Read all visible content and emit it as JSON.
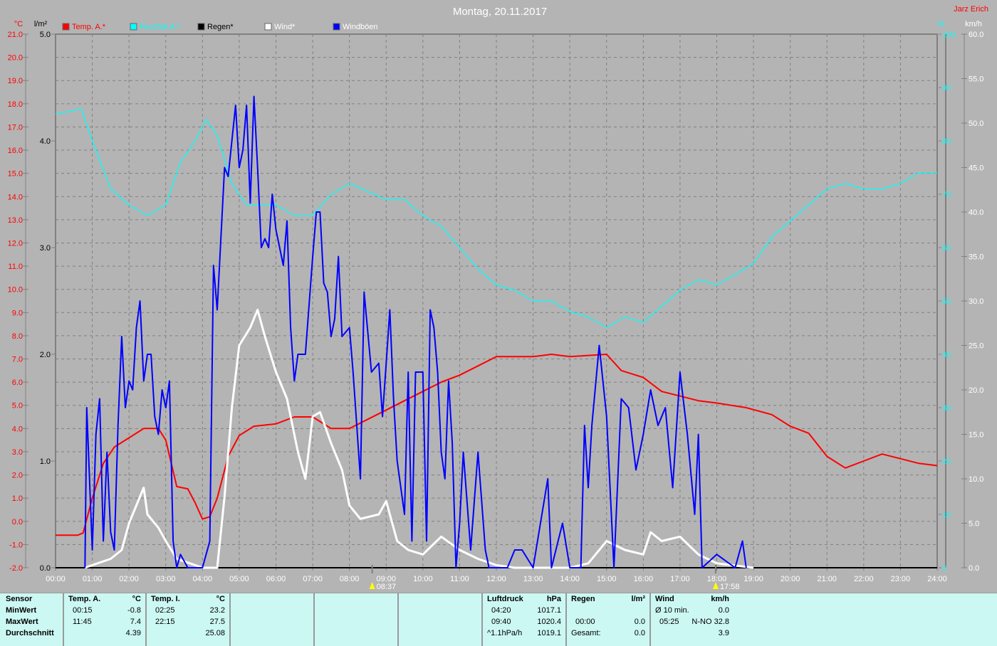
{
  "chart_data": {
    "type": "line",
    "title": "Montag, 20.11.2017",
    "author": "Jarz Erich",
    "legend": [
      {
        "name": "Temp. A.*",
        "color": "#ff0000"
      },
      {
        "name": "Feuchte A.*",
        "color": "#00ffff"
      },
      {
        "name": "Regen*",
        "color": "#000000"
      },
      {
        "name": "Wind*",
        "color": "#ffffff"
      },
      {
        "name": "Windböen",
        "color": "#0000ff"
      }
    ],
    "axes": {
      "temp": {
        "label": "°C",
        "range": [
          -2,
          21
        ],
        "step": 1
      },
      "rain": {
        "label": "l/m²",
        "range": [
          0,
          5
        ],
        "step": 1
      },
      "hum": {
        "label": "%",
        "range": [
          0,
          100
        ],
        "step": 10
      },
      "wind": {
        "label": "km/h",
        "range": [
          0,
          60
        ],
        "step": 5
      },
      "x": {
        "range": [
          0,
          24
        ],
        "ticks": [
          "00:00",
          "01:00",
          "02:00",
          "03:00",
          "04:00",
          "05:00",
          "06:00",
          "07:00",
          "08:00",
          "09:00",
          "10:00",
          "11:00",
          "12:00",
          "13:00",
          "14:00",
          "15:00",
          "16:00",
          "17:00",
          "18:00",
          "19:00",
          "20:00",
          "21:00",
          "22:00",
          "23:00",
          "24:00"
        ]
      }
    },
    "sunrise": {
      "time": "08:37",
      "hour": 8.62
    },
    "sunset": {
      "time": "17:58",
      "hour": 17.97
    },
    "series": [
      {
        "name": "Temp. A.*",
        "axis": "temp",
        "color": "#ff0000",
        "points": [
          [
            0,
            -0.6
          ],
          [
            0.6,
            -0.6
          ],
          [
            0.75,
            -0.5
          ],
          [
            1,
            1
          ],
          [
            1.3,
            2.5
          ],
          [
            1.6,
            3.2
          ],
          [
            2,
            3.6
          ],
          [
            2.4,
            4
          ],
          [
            2.8,
            4
          ],
          [
            3,
            3.5
          ],
          [
            3.3,
            1.5
          ],
          [
            3.6,
            1.4
          ],
          [
            3.8,
            0.8
          ],
          [
            4,
            0.1
          ],
          [
            4.2,
            0.2
          ],
          [
            4.4,
            1
          ],
          [
            4.7,
            2.8
          ],
          [
            5,
            3.7
          ],
          [
            5.4,
            4.1
          ],
          [
            6,
            4.2
          ],
          [
            6.5,
            4.5
          ],
          [
            7,
            4.5
          ],
          [
            7.5,
            4
          ],
          [
            8,
            4
          ],
          [
            8.5,
            4.4
          ],
          [
            9,
            4.8
          ],
          [
            9.5,
            5.2
          ],
          [
            10,
            5.6
          ],
          [
            10.5,
            6
          ],
          [
            11,
            6.3
          ],
          [
            11.5,
            6.7
          ],
          [
            12,
            7.1
          ],
          [
            13,
            7.1
          ],
          [
            13.5,
            7.2
          ],
          [
            14,
            7.1
          ],
          [
            15,
            7.2
          ],
          [
            15.4,
            6.5
          ],
          [
            16,
            6.2
          ],
          [
            16.5,
            5.6
          ],
          [
            17,
            5.4
          ],
          [
            17.5,
            5.2
          ],
          [
            18,
            5.1
          ],
          [
            18.8,
            4.9
          ],
          [
            19.5,
            4.6
          ],
          [
            20,
            4.1
          ],
          [
            20.5,
            3.8
          ],
          [
            21,
            2.8
          ],
          [
            21.5,
            2.3
          ],
          [
            22,
            2.6
          ],
          [
            22.5,
            2.9
          ],
          [
            23,
            2.7
          ],
          [
            23.5,
            2.5
          ],
          [
            24,
            2.4
          ]
        ]
      },
      {
        "name": "Feuchte A.*",
        "axis": "hum",
        "color": "#00ffff",
        "points": [
          [
            0,
            85
          ],
          [
            0.7,
            86
          ],
          [
            1,
            80
          ],
          [
            1.5,
            71
          ],
          [
            2,
            68
          ],
          [
            2.5,
            66
          ],
          [
            3,
            68
          ],
          [
            3.4,
            76
          ],
          [
            3.8,
            80
          ],
          [
            4.1,
            84
          ],
          [
            4.4,
            81
          ],
          [
            4.8,
            72
          ],
          [
            5.2,
            68
          ],
          [
            6,
            68
          ],
          [
            6.5,
            66
          ],
          [
            7,
            66
          ],
          [
            7.5,
            70
          ],
          [
            8,
            72
          ],
          [
            9,
            69
          ],
          [
            9.5,
            69
          ],
          [
            10,
            66
          ],
          [
            10.5,
            64
          ],
          [
            11,
            60
          ],
          [
            11.5,
            56
          ],
          [
            12,
            53
          ],
          [
            12.5,
            52
          ],
          [
            13,
            50
          ],
          [
            13.5,
            50
          ],
          [
            14,
            48
          ],
          [
            14.5,
            47
          ],
          [
            15,
            45
          ],
          [
            15.5,
            47
          ],
          [
            16,
            46
          ],
          [
            16.5,
            49
          ],
          [
            17,
            52
          ],
          [
            17.5,
            54
          ],
          [
            18,
            53
          ],
          [
            18.5,
            55
          ],
          [
            19,
            57
          ],
          [
            19.5,
            62
          ],
          [
            20,
            65
          ],
          [
            20.5,
            68
          ],
          [
            21,
            71
          ],
          [
            21.5,
            72
          ],
          [
            22,
            71
          ],
          [
            22.5,
            71
          ],
          [
            23,
            72
          ],
          [
            23.5,
            74
          ],
          [
            24,
            74
          ]
        ]
      },
      {
        "name": "Wind*",
        "axis": "wind",
        "color": "#ffffff",
        "points": [
          [
            0.8,
            0
          ],
          [
            1,
            0.3
          ],
          [
            1.5,
            1
          ],
          [
            1.8,
            2
          ],
          [
            2,
            5
          ],
          [
            2.3,
            8
          ],
          [
            2.4,
            9
          ],
          [
            2.5,
            6
          ],
          [
            2.8,
            4.5
          ],
          [
            3,
            3
          ],
          [
            3.3,
            1
          ],
          [
            3.8,
            0.3
          ],
          [
            4,
            0
          ],
          [
            4.4,
            0
          ],
          [
            4.6,
            8
          ],
          [
            4.8,
            18
          ],
          [
            5,
            25
          ],
          [
            5.3,
            27
          ],
          [
            5.5,
            29
          ],
          [
            5.7,
            26
          ],
          [
            6,
            22
          ],
          [
            6.3,
            19
          ],
          [
            6.6,
            13
          ],
          [
            6.8,
            10
          ],
          [
            7,
            17
          ],
          [
            7.2,
            17.5
          ],
          [
            7.5,
            14
          ],
          [
            7.8,
            11
          ],
          [
            8,
            7
          ],
          [
            8.3,
            5.5
          ],
          [
            8.8,
            6
          ],
          [
            9,
            7.5
          ],
          [
            9.3,
            3
          ],
          [
            9.6,
            2
          ],
          [
            10,
            1.5
          ],
          [
            10.5,
            3.5
          ],
          [
            11,
            2
          ],
          [
            11.5,
            1
          ],
          [
            12,
            0.3
          ],
          [
            12.5,
            0
          ],
          [
            14,
            0
          ],
          [
            14.5,
            0.5
          ],
          [
            15,
            3
          ],
          [
            15.5,
            2
          ],
          [
            16,
            1.5
          ],
          [
            16.2,
            4
          ],
          [
            16.5,
            3
          ],
          [
            17,
            3.5
          ],
          [
            17.5,
            1.5
          ],
          [
            18,
            0.5
          ],
          [
            19,
            0
          ]
        ]
      },
      {
        "name": "Windböen",
        "axis": "wind",
        "color": "#0000ff",
        "points": [
          [
            0.8,
            0
          ],
          [
            0.85,
            18
          ],
          [
            1,
            2
          ],
          [
            1.1,
            15
          ],
          [
            1.2,
            19
          ],
          [
            1.3,
            3
          ],
          [
            1.4,
            13
          ],
          [
            1.5,
            4
          ],
          [
            1.6,
            2
          ],
          [
            1.7,
            16
          ],
          [
            1.8,
            26
          ],
          [
            1.9,
            18
          ],
          [
            2,
            21
          ],
          [
            2.1,
            20
          ],
          [
            2.2,
            27
          ],
          [
            2.3,
            30
          ],
          [
            2.4,
            21
          ],
          [
            2.5,
            24
          ],
          [
            2.6,
            24
          ],
          [
            2.7,
            17
          ],
          [
            2.8,
            15
          ],
          [
            2.9,
            20
          ],
          [
            3,
            18
          ],
          [
            3.1,
            21
          ],
          [
            3.2,
            3
          ],
          [
            3.3,
            0
          ],
          [
            3.4,
            1.5
          ],
          [
            3.6,
            0
          ],
          [
            4,
            0
          ],
          [
            4.2,
            3
          ],
          [
            4.3,
            34
          ],
          [
            4.4,
            29
          ],
          [
            4.6,
            45
          ],
          [
            4.7,
            44
          ],
          [
            4.9,
            52
          ],
          [
            5,
            45
          ],
          [
            5.1,
            47
          ],
          [
            5.2,
            52
          ],
          [
            5.3,
            41
          ],
          [
            5.4,
            53
          ],
          [
            5.5,
            45
          ],
          [
            5.6,
            36
          ],
          [
            5.7,
            37
          ],
          [
            5.8,
            36
          ],
          [
            5.9,
            42
          ],
          [
            6,
            38
          ],
          [
            6.2,
            34
          ],
          [
            6.3,
            39
          ],
          [
            6.4,
            27
          ],
          [
            6.5,
            21
          ],
          [
            6.6,
            24
          ],
          [
            6.8,
            24
          ],
          [
            7,
            35
          ],
          [
            7.1,
            40
          ],
          [
            7.2,
            40
          ],
          [
            7.3,
            32
          ],
          [
            7.4,
            31
          ],
          [
            7.5,
            26
          ],
          [
            7.6,
            28
          ],
          [
            7.7,
            35
          ],
          [
            7.8,
            26
          ],
          [
            8,
            27
          ],
          [
            8.1,
            22
          ],
          [
            8.3,
            10
          ],
          [
            8.4,
            31
          ],
          [
            8.6,
            22
          ],
          [
            8.8,
            23
          ],
          [
            8.9,
            17
          ],
          [
            9,
            23
          ],
          [
            9.1,
            29
          ],
          [
            9.2,
            19
          ],
          [
            9.3,
            12
          ],
          [
            9.5,
            6
          ],
          [
            9.6,
            22
          ],
          [
            9.7,
            3
          ],
          [
            9.8,
            22
          ],
          [
            10,
            22
          ],
          [
            10.1,
            3
          ],
          [
            10.2,
            29
          ],
          [
            10.3,
            27
          ],
          [
            10.4,
            22
          ],
          [
            10.5,
            13
          ],
          [
            10.6,
            10
          ],
          [
            10.7,
            21
          ],
          [
            10.8,
            14
          ],
          [
            10.9,
            0
          ],
          [
            11,
            5
          ],
          [
            11.1,
            13
          ],
          [
            11.3,
            2
          ],
          [
            11.5,
            13
          ],
          [
            11.7,
            2
          ],
          [
            11.8,
            0
          ],
          [
            12.3,
            0
          ],
          [
            12.5,
            2
          ],
          [
            12.7,
            2
          ],
          [
            13,
            0
          ],
          [
            13.4,
            10
          ],
          [
            13.5,
            0
          ],
          [
            13.8,
            5
          ],
          [
            14,
            0
          ],
          [
            14.3,
            0
          ],
          [
            14.4,
            16
          ],
          [
            14.5,
            9
          ],
          [
            14.6,
            16
          ],
          [
            14.8,
            25
          ],
          [
            15,
            17
          ],
          [
            15.2,
            0
          ],
          [
            15.4,
            19
          ],
          [
            15.6,
            18
          ],
          [
            15.8,
            11
          ],
          [
            16,
            15
          ],
          [
            16.2,
            20
          ],
          [
            16.4,
            16
          ],
          [
            16.6,
            18
          ],
          [
            16.8,
            9
          ],
          [
            17,
            22
          ],
          [
            17.2,
            15
          ],
          [
            17.4,
            6
          ],
          [
            17.5,
            15
          ],
          [
            17.6,
            0
          ],
          [
            18,
            1.5
          ],
          [
            18.5,
            0
          ],
          [
            18.7,
            3
          ],
          [
            18.8,
            0
          ]
        ]
      }
    ]
  },
  "table": {
    "sensor": {
      "header": "Sensor",
      "rows": [
        "MinWert",
        "MaxWert",
        "Durchschnitt"
      ]
    },
    "temp_a": {
      "header": "Temp. A.",
      "unit": "°C",
      "min_time": "00:15",
      "min": "-0.8",
      "max_time": "11:45",
      "max": "7.4",
      "avg": "4.39"
    },
    "temp_i": {
      "header": "Temp. I.",
      "unit": "°C",
      "min_time": "02:25",
      "min": "23.2",
      "max_time": "22:15",
      "max": "27.5",
      "avg": "25.08"
    },
    "pressure": {
      "header": "Luftdruck",
      "unit": "hPa",
      "min_time": "04:20",
      "min": "1017.1",
      "max_time": "09:40",
      "max": "1020.4",
      "trend": "^1.1hPa/h",
      "current": "1019.1"
    },
    "rain": {
      "header": "Regen",
      "unit": "l/m²",
      "time": "00:00",
      "value": "0.0",
      "total_label": "Gesamt:",
      "total": "0.0"
    },
    "wind": {
      "header": "Wind",
      "unit": "km/h",
      "avg10_label": "Ø 10 min.",
      "avg10": "0.0",
      "max_time": "05:25",
      "max": "N-NO 32.8",
      "avg": "3.9"
    }
  }
}
